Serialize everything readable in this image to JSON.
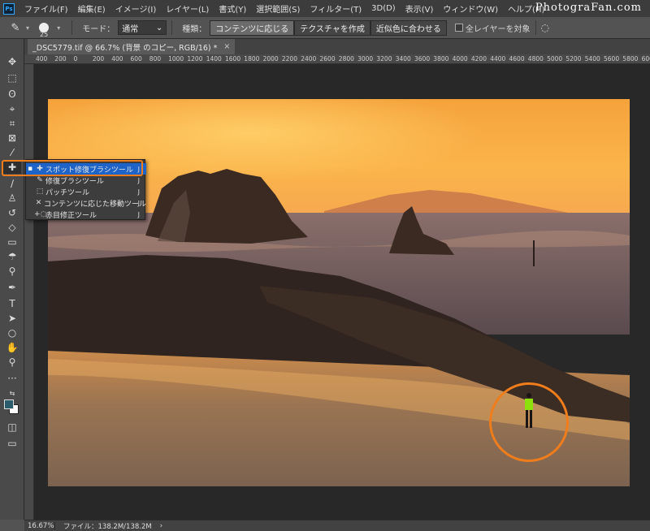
{
  "menubar": {
    "app_icon": "Ps",
    "items": [
      "ファイル(F)",
      "編集(E)",
      "イメージ(I)",
      "レイヤー(L)",
      "書式(Y)",
      "選択範囲(S)",
      "フィルター(T)",
      "3D(D)",
      "表示(V)",
      "ウィンドウ(W)",
      "ヘルプ(H)"
    ],
    "brand": "PhotograFan.com"
  },
  "options": {
    "brush_size": "25",
    "mode_label": "モード：",
    "mode_value": "通常",
    "type_label": "種類：",
    "type_buttons": [
      "コンテンツに応じる",
      "テクスチャを作成",
      "近似色に合わせる"
    ],
    "sample_all_label": "全レイヤーを対象"
  },
  "document": {
    "tab_title": "_DSC5779.tif @ 66.7% (背景 のコピー, RGB/16) *",
    "close": "×"
  },
  "ruler": {
    "ticks": [
      "400",
      "200",
      "0",
      "200",
      "400",
      "600",
      "800",
      "1000",
      "1200",
      "1400",
      "1600",
      "1800",
      "2000",
      "2200",
      "2400",
      "2600",
      "2800",
      "3000",
      "3200",
      "3400",
      "3600",
      "3800",
      "4000",
      "4200",
      "4400",
      "4600",
      "4800",
      "5000",
      "5200",
      "5400",
      "5600",
      "5800",
      "6000"
    ]
  },
  "flyout": {
    "items": [
      {
        "icon": "spot-healing-brush-icon",
        "label": "スポット修復ブラシツール",
        "key": "J",
        "current": true
      },
      {
        "icon": "healing-brush-icon",
        "label": "修復ブラシツール",
        "key": "J",
        "current": false
      },
      {
        "icon": "patch-icon",
        "label": "パッチツール",
        "key": "J",
        "current": false
      },
      {
        "icon": "content-aware-move-icon",
        "label": "コンテンツに応じた移動ツール",
        "key": "J",
        "current": false
      },
      {
        "icon": "red-eye-icon",
        "label": "赤目修正ツール",
        "key": "J",
        "current": false
      }
    ]
  },
  "status": {
    "zoom": "16.67%",
    "file_info": "ファイル：138.2M/138.2M",
    "arrow": "›"
  },
  "colors": {
    "highlight": "#f07d1c",
    "foreground_swatch": "#2b5c6b",
    "background_swatch": "#ffffff"
  }
}
